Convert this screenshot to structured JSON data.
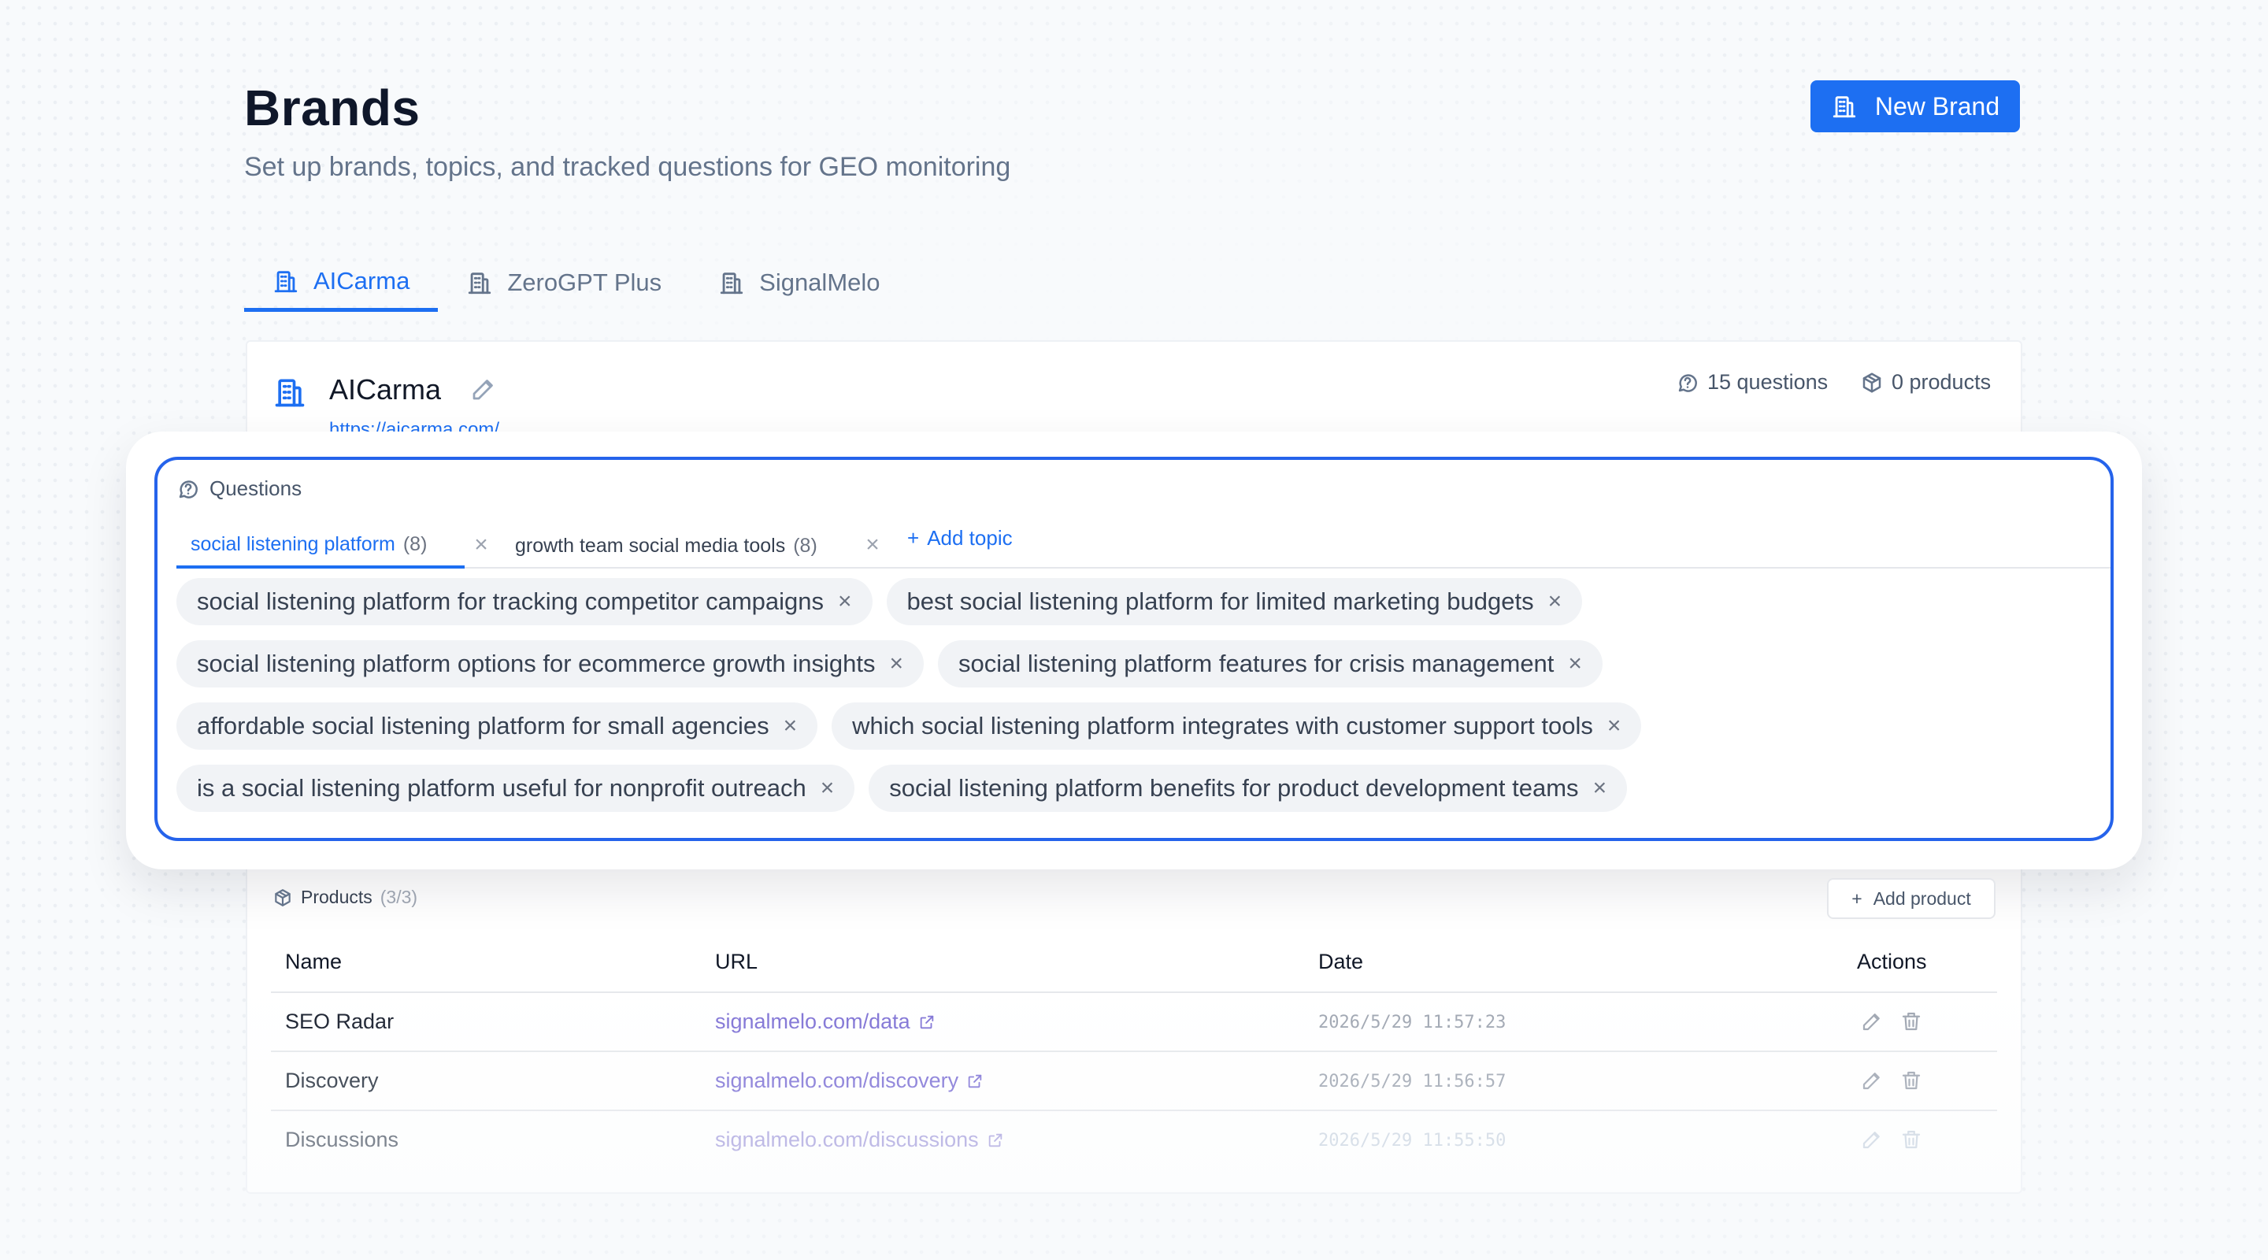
{
  "page": {
    "title": "Brands",
    "subtitle": "Set up brands, topics, and tracked questions for GEO monitoring",
    "new_brand_label": "New Brand",
    "accent_color": "#1d6ff2"
  },
  "tabs": [
    {
      "label": "AICarma",
      "active": true
    },
    {
      "label": "ZeroGPT Plus",
      "active": false
    },
    {
      "label": "SignalMelo",
      "active": false
    }
  ],
  "brand": {
    "name": "AICarma",
    "url": "https://aicarma.com/",
    "questions_stat": "15 questions",
    "products_stat": "0 products"
  },
  "questions": {
    "header": "Questions",
    "topics": [
      {
        "label": "social listening platform",
        "count": "(8)",
        "active": true
      },
      {
        "label": "growth team social media tools",
        "count": "(8)",
        "active": false
      }
    ],
    "add_topic_label": "Add topic",
    "items": [
      "social listening platform for tracking competitor campaigns",
      "best social listening platform for limited marketing budgets",
      "social listening platform options for ecommerce growth insights",
      "social listening platform features for crisis management",
      "affordable social listening platform for small agencies",
      "which social listening platform integrates with customer support tools",
      "is a social listening platform useful for nonprofit outreach",
      "social listening platform benefits for product development teams"
    ]
  },
  "products": {
    "header": "Products",
    "count": "(3/3)",
    "add_label": "Add product",
    "columns": [
      "Name",
      "URL",
      "Date",
      "Actions"
    ],
    "rows": [
      {
        "name": "SEO Radar",
        "url": "signalmelo.com/data",
        "date": "2026/5/29 11:57:23"
      },
      {
        "name": "Discovery",
        "url": "signalmelo.com/discovery",
        "date": "2026/5/29 11:56:57"
      },
      {
        "name": "Discussions",
        "url": "signalmelo.com/discussions",
        "date": "2026/5/29 11:55:50"
      }
    ]
  },
  "icons": {
    "brand": "building-icon",
    "questions": "question-circle-icon",
    "products": "package-icon",
    "edit": "pencil-icon",
    "delete": "trash-icon",
    "external": "external-link-icon"
  }
}
